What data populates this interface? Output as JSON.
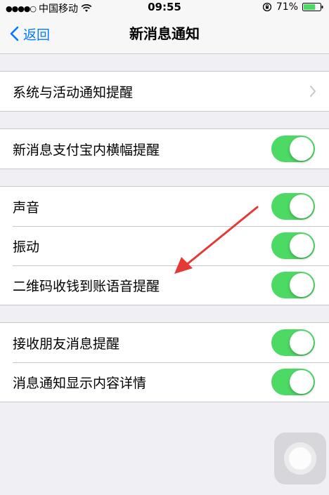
{
  "status_bar": {
    "signal_dots": "●●●●○",
    "carrier": "中国移动",
    "time": "09:55",
    "battery_percent": "71%",
    "battery_level": 0.71
  },
  "nav": {
    "back_label": "返回",
    "title": "新消息通知"
  },
  "groups": {
    "system": {
      "label": "系统与活动通知提醒"
    },
    "banner": {
      "label": "新消息支付宝内横幅提醒",
      "on": true
    },
    "sound": {
      "sound_label": "声音",
      "vibrate_label": "振动",
      "qr_voice_label": "二维码收钱到账语音提醒"
    },
    "friends": {
      "friend_msg_label": "接收朋友消息提醒",
      "show_detail_label": "消息通知显示内容详情"
    }
  },
  "colors": {
    "accent": "#007aff",
    "toggle_on": "#4cd964",
    "background": "#efeff4",
    "arrow": "#e53935"
  }
}
